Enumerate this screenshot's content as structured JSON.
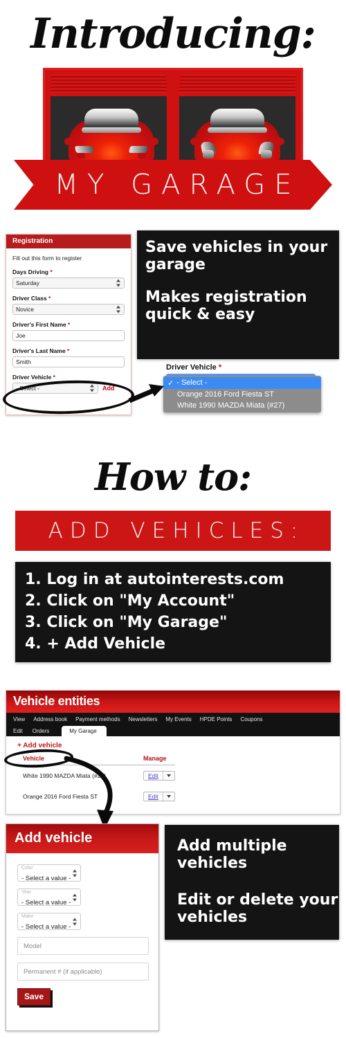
{
  "intro": {
    "title": "Introducing:",
    "ribbon_text": "MY GARAGE"
  },
  "benefits": {
    "line1": "Save vehicles in your garage",
    "line2": "Makes registration quick & easy"
  },
  "registration": {
    "header": "Registration",
    "intro_text": "Fill out this form to register",
    "fields": [
      {
        "label": "Days Driving",
        "required": "*",
        "value": "Saturday",
        "type": "select"
      },
      {
        "label": "Driver Class",
        "required": "*",
        "value": "Novice",
        "type": "select"
      },
      {
        "label": "Driver's First Name",
        "required": "*",
        "value": "Joe",
        "type": "text"
      },
      {
        "label": "Driver's Last Name",
        "required": "*",
        "value": "Smith",
        "type": "text"
      },
      {
        "label": "Driver Vehicle",
        "required": "*",
        "value": "- Select -",
        "type": "select"
      }
    ],
    "add_link": "Add"
  },
  "vehicle_dropdown": {
    "label": "Driver Vehicle",
    "required": "*",
    "options": [
      {
        "text": "- Select -",
        "selected": true,
        "check": "✓"
      },
      {
        "text": "Orange 2016 Ford Fiesta ST",
        "selected": false
      },
      {
        "text": "White 1990 MAZDA Miata (#27)",
        "selected": false
      }
    ],
    "selected_bg": "#3b8bf5",
    "list_bg": "#8c8c8c"
  },
  "howto": {
    "title": "How to:",
    "banner": "ADD VEHICLES:",
    "steps": [
      "1. Log in at autointerests.com",
      "2. Click on \"My Account\"",
      "3. Click on \"My Garage\"",
      "4. + Add Vehicle"
    ]
  },
  "vehicle_entities": {
    "header": "Vehicle entities",
    "tabs_row1": [
      "View",
      "Address book",
      "Payment methods",
      "Newsletters",
      "My Events",
      "HPDE Points",
      "Coupons"
    ],
    "tabs_row2": [
      "Edit",
      "Orders"
    ],
    "active_tab": "My Garage",
    "add_action": "+ Add vehicle",
    "table": {
      "columns": [
        "Vehicle",
        "Manage"
      ],
      "rows": [
        {
          "vehicle": "White 1990 MAZDA Miata (#27)",
          "action": "Edit"
        },
        {
          "vehicle": "Orange 2016 Ford Fiesta ST",
          "action": "Edit"
        }
      ]
    }
  },
  "add_vehicle": {
    "header": "Add vehicle",
    "selects": [
      {
        "label": "Color",
        "value": "- Select a value -"
      },
      {
        "label": "Year",
        "value": "- Select a value -"
      },
      {
        "label": "Make",
        "value": "- Select a value -"
      }
    ],
    "inputs": [
      {
        "placeholder": "Model"
      },
      {
        "placeholder": "Permanent # (if applicable)"
      }
    ],
    "save_label": "Save"
  },
  "multi": {
    "line1": "Add multiple vehicles",
    "line2": "Edit or delete your vehicles"
  },
  "colors": {
    "brand_red": "#cf1010",
    "banner_red": "#cc1616",
    "dark": "#141414",
    "required": "#d0021b"
  }
}
